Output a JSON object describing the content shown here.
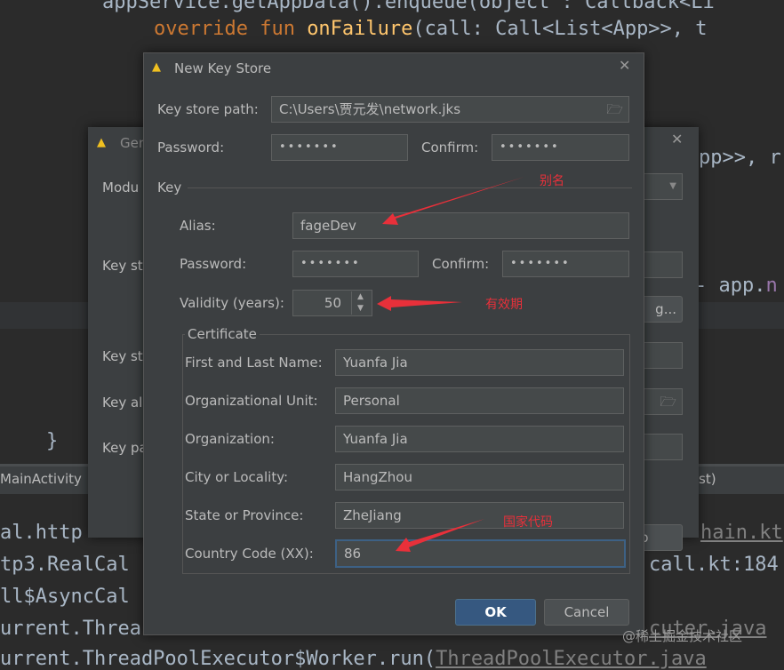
{
  "editor": {
    "line1": "appService.getAppData().enqueue(object : Callback<Li",
    "line2_kw": "override fun ",
    "line2_fn": "onFailure",
    "line2_rest": "(call: Call<List<App>>, t",
    "right1": "pp>>, r",
    "right2": "- app.",
    "right2_prop": "n",
    "brace": "}",
    "tab_main": "MainActivity",
    "tab_right": "st)",
    "log": [
      "al.http",
      "tp3.RealCal",
      "ll$AsyncCal",
      "urrent.Threa",
      "urrent.ThreadPoolExecutor$Worker.run("
    ],
    "log_right": [
      "hain.kt",
      "call.kt:184",
      "",
      "cuter.java",
      "ThreadPoolExecutor.java"
    ]
  },
  "back_dialog": {
    "title": "Ger",
    "labels": [
      "Modu",
      "Key st",
      "Key st",
      "Key al",
      "Key pa"
    ],
    "button1": "g...",
    "button2": "p"
  },
  "dialog": {
    "title": "New Key Store",
    "keystore_path_label": "Key store path:",
    "keystore_path": "C:\\Users\\贾元发\\network.jks",
    "password_label": "Password:",
    "password": "•••••••",
    "confirm_label": "Confirm:",
    "confirm": "•••••••",
    "key_section": "Key",
    "alias_label": "Alias:",
    "alias": "fageDev",
    "key_password_label": "Password:",
    "key_password": "•••••••",
    "key_confirm_label": "Confirm:",
    "key_confirm": "•••••••",
    "validity_label": "Validity (years):",
    "validity": "50",
    "certificate_section": "Certificate",
    "certificate": [
      {
        "label": "First and Last Name:",
        "value": "Yuanfa Jia"
      },
      {
        "label": "Organizational Unit:",
        "value": "Personal"
      },
      {
        "label": "Organization:",
        "value": "Yuanfa Jia"
      },
      {
        "label": "City or Locality:",
        "value": "HangZhou"
      },
      {
        "label": "State or Province:",
        "value": "ZheJiang"
      },
      {
        "label": "Country Code (XX):",
        "value": "86"
      }
    ],
    "ok": "OK",
    "cancel": "Cancel"
  },
  "annotations": {
    "alias": "别名",
    "validity": "有效期",
    "country": "国家代码"
  },
  "watermark": "@稀土掘金技术社区",
  "colors": {
    "accent": "#365880",
    "focus": "#3d6185",
    "annotation": "#e8303a"
  }
}
